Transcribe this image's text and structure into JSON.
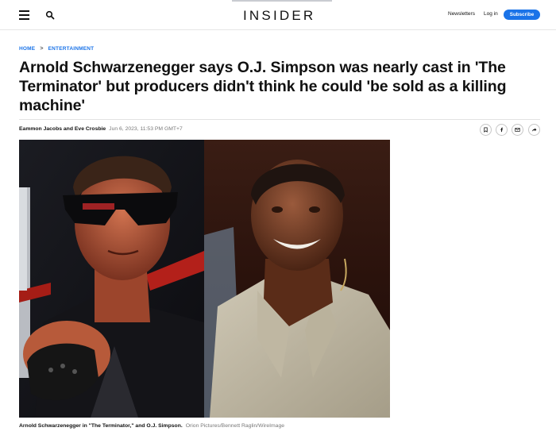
{
  "header": {
    "logo": "INSIDER",
    "newsletters_label": "Newsletters",
    "login_label": "Log in",
    "subscribe_label": "Subscribe",
    "menu_icon": "hamburger-menu-icon",
    "search_icon": "search-icon"
  },
  "breadcrumb": {
    "home": "HOME",
    "separator": ">",
    "section": "ENTERTAINMENT"
  },
  "article": {
    "headline": "Arnold Schwarzenegger says O.J. Simpson was nearly cast in 'The Terminator' but producers didn't think he could 'be sold as a killing machine'",
    "authors": "Eammon Jacobs and Eve Crosbie",
    "date": "Jun 6, 2023, 11:53 PM GMT+7",
    "share_icons": [
      "bookmark-icon",
      "facebook-icon",
      "email-icon",
      "share-forward-icon"
    ]
  },
  "image": {
    "caption": "Arnold Schwarzenegger in \"The Terminator,\" and O.J. Simpson.",
    "credit": "Orion Pictures/Bennett Raglin/WireImage"
  },
  "colors": {
    "accent_blue": "#1a73e8",
    "text": "#111111",
    "muted": "#777777"
  }
}
